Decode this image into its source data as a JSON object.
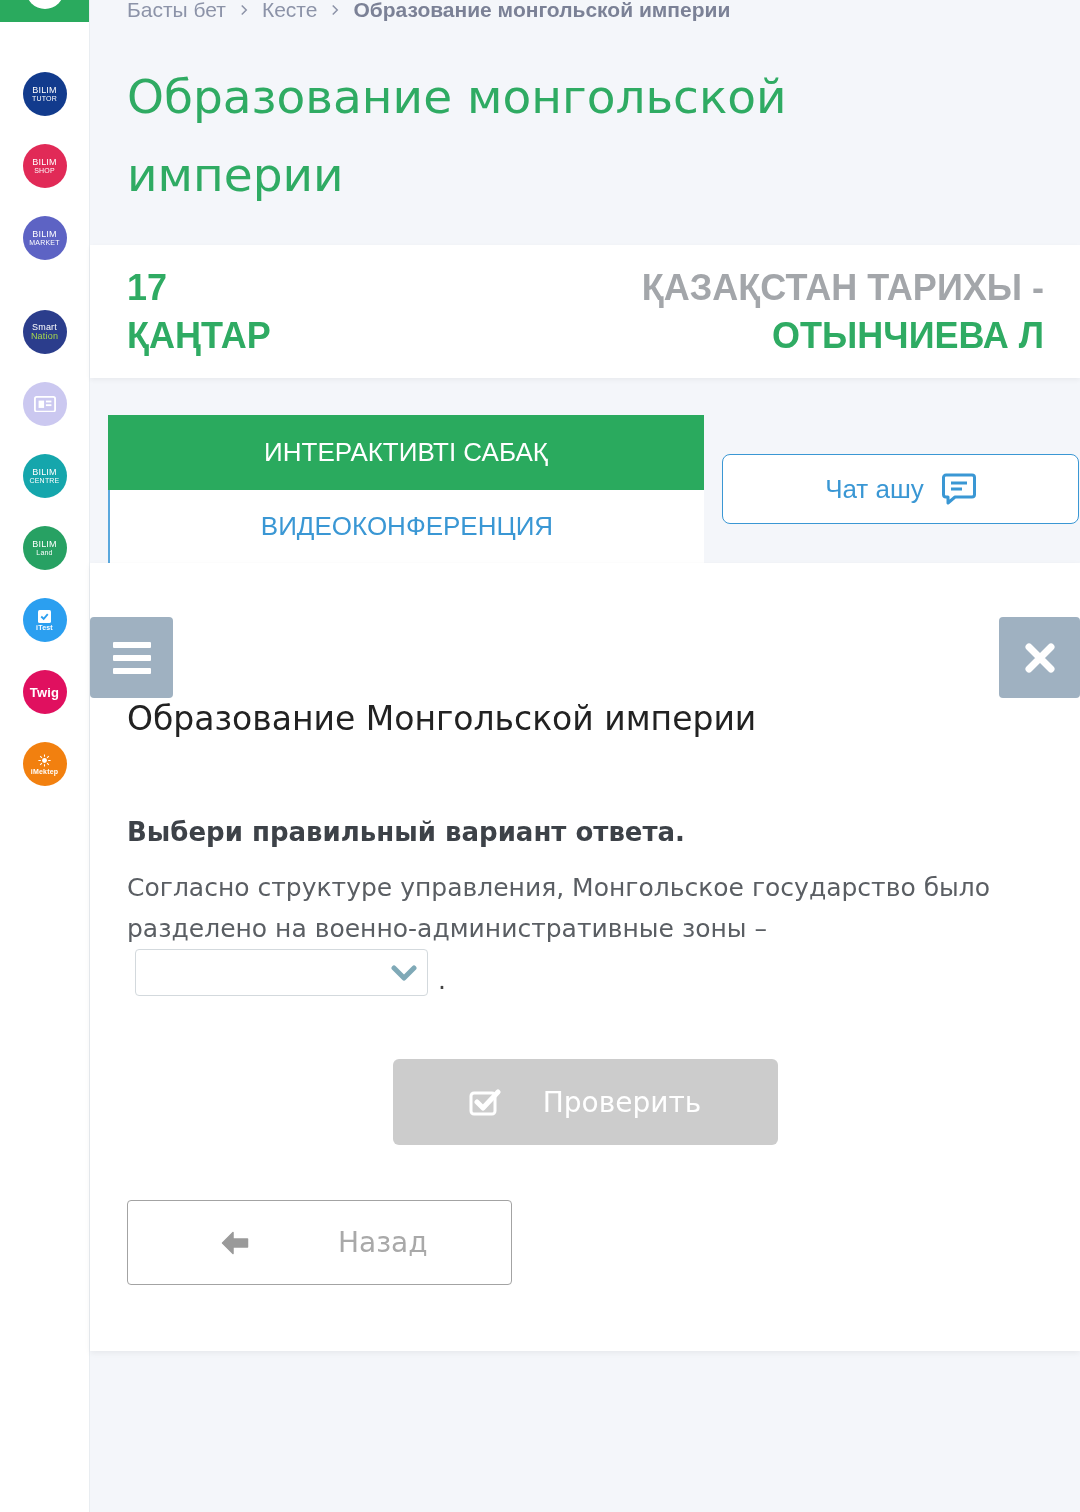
{
  "sidebar": {
    "groups": [
      {
        "items": [
          {
            "kind": "wordmark",
            "lines": [
              "BILIM",
              "TUTOR"
            ],
            "color": "#123b8d"
          },
          {
            "kind": "wordmark",
            "lines": [
              "BILIM",
              "SHOP"
            ],
            "color": "#e12a57"
          },
          {
            "kind": "wordmark",
            "lines": [
              "BILIM",
              "MARKET"
            ],
            "color": "#5d63c4"
          }
        ]
      },
      {
        "items": [
          {
            "kind": "two_tone",
            "lines": [
              "Smart",
              "Nation"
            ],
            "color": "#2b3d8c"
          },
          {
            "kind": "picture",
            "color": "#cbc8f0"
          },
          {
            "kind": "wordmark",
            "lines": [
              "BILIM",
              "CENTRE"
            ],
            "color": "#15a6ac"
          },
          {
            "kind": "wordmark",
            "lines": [
              "BILIM",
              "Land"
            ],
            "color": "#27a163"
          },
          {
            "kind": "tick",
            "lines": [
              "iTest"
            ],
            "color": "#2b9ff0"
          },
          {
            "kind": "wordmark",
            "lines": [
              "Twig"
            ],
            "color": "#e0105f"
          },
          {
            "kind": "sun",
            "lines": [
              "iMektep"
            ],
            "color": "#f2800f"
          }
        ]
      }
    ]
  },
  "breadcrumb": [
    {
      "label": "Басты бет",
      "current": false
    },
    {
      "label": "Кесте",
      "current": false
    },
    {
      "label": "Образование монгольской империи",
      "current": true
    }
  ],
  "page_title": "Образование монгольской империи",
  "lesson": {
    "date": "17 ҚАҢТАР",
    "subject": "ҚАЗАҚСТАН ТАРИХЫ -",
    "teacher": "ОТЫНЧИЕВА Л"
  },
  "tabs": [
    {
      "label": "ИНТЕРАКТИВТІ САБАҚ",
      "selected": true
    },
    {
      "label": "ВИДЕОКОНФЕРЕНЦИЯ",
      "selected": false
    }
  ],
  "chat_button": {
    "label": "Чат ашу"
  },
  "task": {
    "title": "Образование Монгольской империи",
    "instruction": "Выбери правильный вариант ответа.",
    "question": "Согласно структуре управления, Монгольское государство было разделено на военно-административные зоны –",
    "after_answer": ".",
    "check_button": {
      "label": "Проверить",
      "disabled": true
    },
    "back_button": {
      "label": "Назад"
    }
  }
}
